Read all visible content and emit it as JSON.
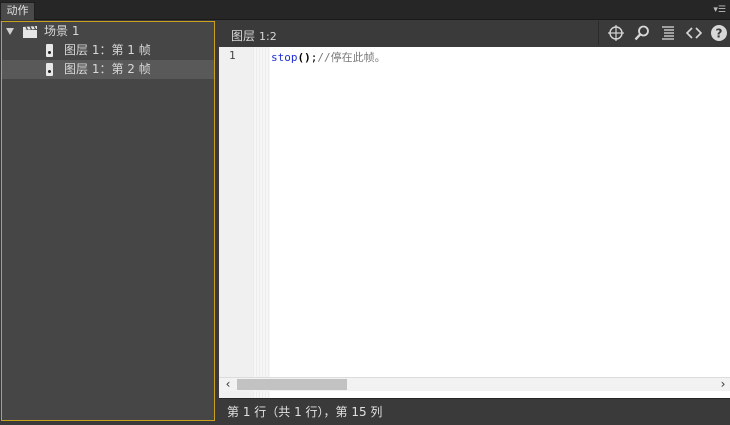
{
  "panel": {
    "tab_label": "动作",
    "menu_glyph": "▾☰"
  },
  "tree": {
    "scene_label": "场景 1",
    "frames": [
      {
        "label": "图层 1：第 1 帧",
        "selected": false
      },
      {
        "label": "图层 1：第 2 帧",
        "selected": true
      }
    ]
  },
  "editor": {
    "breadcrumb_layer": "图层",
    "breadcrumb_frame": "1:2",
    "toolbar": [
      "target-icon",
      "search-icon",
      "format-icon",
      "code-snippet-icon",
      "help-icon"
    ],
    "line_number": "1",
    "code": {
      "keyword": "stop",
      "parens": "()",
      "semicolon": ";",
      "comment": "//停在此帧。"
    },
    "status": "第 1 行（共 1 行），第 15 列"
  },
  "colors": {
    "accent_border": "#c8a21e",
    "keyword": "#1f2fd0",
    "comment": "#7a7a7a"
  }
}
